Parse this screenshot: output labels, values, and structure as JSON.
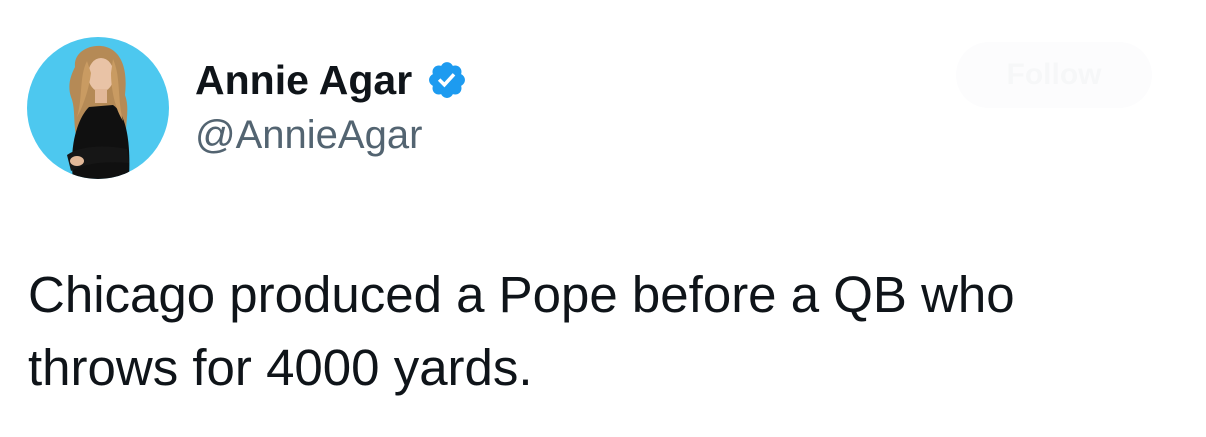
{
  "author": {
    "display_name": "Annie Agar",
    "handle": "@AnnieAgar",
    "verified_icon": "verified-badge-icon",
    "avatar_bg": "#4dc8ef"
  },
  "follow_button": {
    "label": "Follow"
  },
  "tweet": {
    "text": "Chicago produced a Pope before a QB who\nthrows for 4000 yards."
  },
  "colors": {
    "text_primary": "#0f1419",
    "text_secondary": "#536471",
    "verified_blue": "#1d9bf0"
  }
}
